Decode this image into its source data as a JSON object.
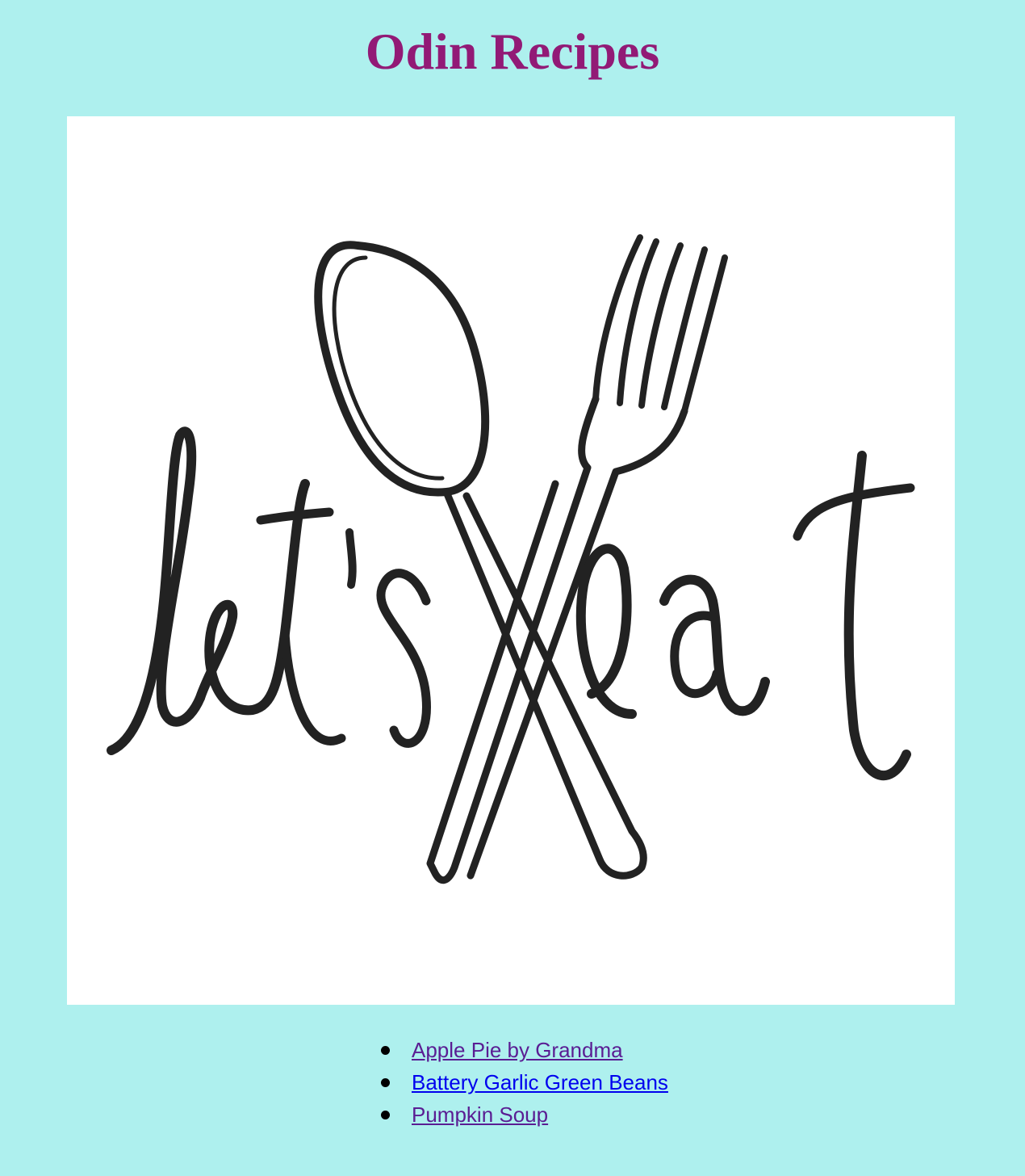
{
  "page": {
    "title": "Odin Recipes",
    "background_color": "#aef0ee",
    "title_color": "#921a76"
  },
  "hero": {
    "image": "lets-eat-spoon-fork-logo"
  },
  "recipes": {
    "items": [
      {
        "label": "Apple Pie by Grandma",
        "state": "visited",
        "color": "#5a1d93"
      },
      {
        "label": "Battery Garlic Green Beans",
        "state": "unvisited",
        "color": "#0000ee"
      },
      {
        "label": "Pumpkin Soup",
        "state": "visited",
        "color": "#5a1d93"
      }
    ]
  }
}
